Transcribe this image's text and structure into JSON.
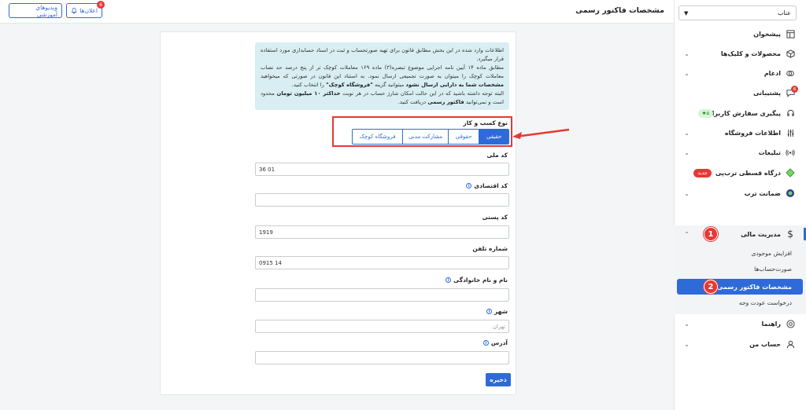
{
  "header": {
    "title": "مشخصات فاکتور رسمی",
    "announcements_label": "اعلان‌ها",
    "announcements_count": "6",
    "videos_label": "ویدیوهای آموزشی"
  },
  "sidebar": {
    "shop_select": "عناب",
    "items": [
      {
        "label": "پیشخوان",
        "icon": "layout-icon"
      },
      {
        "label": "محصولات و کلیک‌ها",
        "icon": "box-icon"
      },
      {
        "label": "ادغام",
        "icon": "merge-icon"
      },
      {
        "label": "پشتیبانی",
        "icon": "chat-icon",
        "badge": "6"
      },
      {
        "label": "پیگیری سفارش کاربران",
        "icon": "headset-icon",
        "pill": "۵★"
      },
      {
        "label": "اطلاعات فروشگاه",
        "icon": "sliders-icon"
      },
      {
        "label": "تبلیغات",
        "icon": "broadcast-icon"
      },
      {
        "label": "درگاه قسطی ترب‌پی",
        "icon": "diamond-icon",
        "pill": "جدید"
      },
      {
        "label": "ضمانت ترب",
        "icon": "shield-icon"
      }
    ],
    "finance": {
      "label": "مدیریت مالی",
      "sub_items": [
        "افزایش موجودی",
        "صورت‌حساب‌ها",
        "مشخصات فاکتور رسمی",
        "درخواست عودت وجه"
      ]
    },
    "bottom_items": [
      {
        "label": "راهنما",
        "icon": "lifebuoy-icon"
      },
      {
        "label": "حساب من",
        "icon": "user-icon"
      }
    ],
    "markers": [
      "1",
      "2"
    ]
  },
  "info": {
    "p1": "اطلاعات وارد شده در این بخش مطابق قانون برای تهیه صورتحساب و ثبت در اسناد حسابداری مورد استفاده قرار میگیرد.",
    "p2": "مطابق ماده ۱۴ آیین نامه اجرایی موضوع تبصره(۳) ماده ۱۶۹ معاملات کوچک تر از پنج درصد حد نصاب معاملات کوچک را میتوان به صورت تجمیعی ارسال نمود. به استناد این قانون در صورتی که میخواهید",
    "p3_bold": "مشخصات شما به دارایی ارسال نشود",
    "p3_rest": "میتوانید گزینه",
    "p3_quote": "\"فروشگاه کوچک\"",
    "p3_end": "را انتخاب کنید.",
    "p4": "البته توجه داشته باشید که در این حالت امکان شارژ حساب در هر نوبت",
    "p4_bold": "حداکثر ۱۰ میلیون تومان",
    "p4_end": "محدود است و نمی‌توانید",
    "p4_bold2": "فاکتور رسمی",
    "p4_end2": "دریافت کنید."
  },
  "form": {
    "business_type_label": "نوع کسب و کار",
    "business_types": [
      "حقیقی",
      "حقوقی",
      "مشارکت مدنی",
      "فروشگاه کوچک"
    ],
    "national_id_label": "کد ملی",
    "national_id_value": "36         01",
    "economic_code_label": "کد اقتصادی",
    "economic_code_value": "",
    "postal_code_label": "کد پستی",
    "postal_code_value": "1919",
    "phone_label": "شماره تلفن",
    "phone_value": "0915          14",
    "name_label": "نام و نام خانوادگی",
    "name_value": "",
    "city_label": "شهر",
    "city_value": "تهران",
    "address_label": "آدرس",
    "address_value": "",
    "save_label": "ذخیره"
  },
  "colors": {
    "accent": "#2e6bd9",
    "highlight": "#e53935",
    "info_bg": "#d8eef3"
  }
}
